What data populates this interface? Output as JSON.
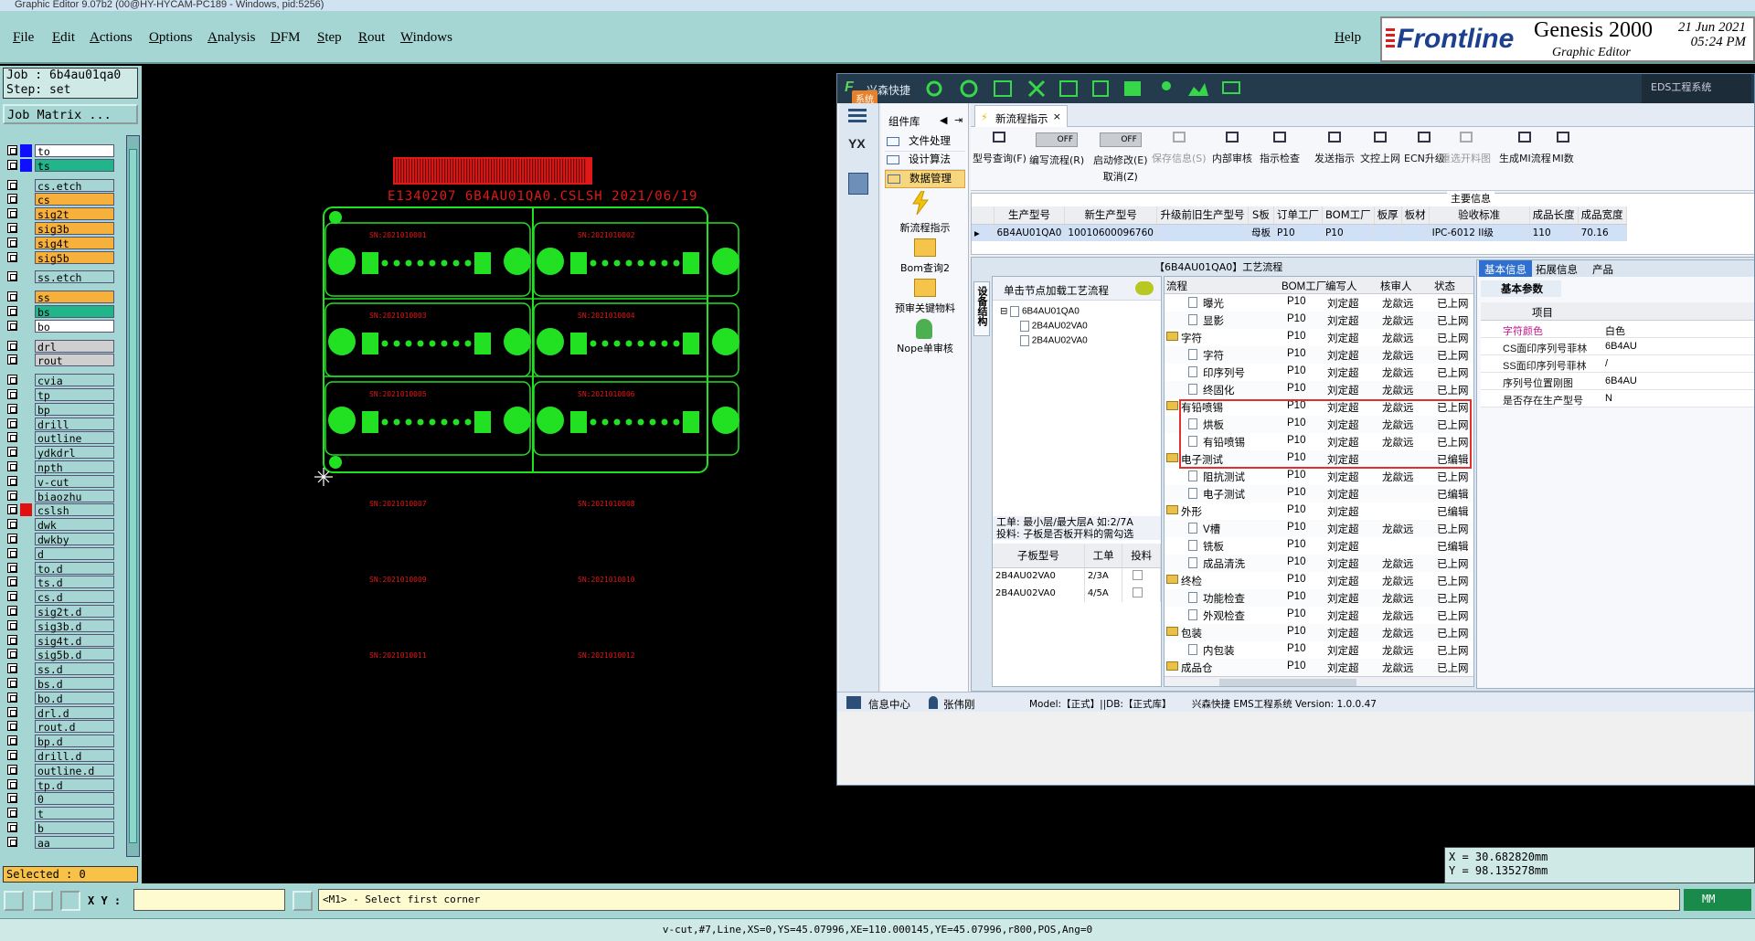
{
  "titlebar": {
    "text": "Graphic Editor 9.07b2 (00@HY-HYCAM-PC189 - Windows, pid:5256)"
  },
  "menu": {
    "items": [
      "File",
      "Edit",
      "Actions",
      "Options",
      "Analysis",
      "DFM",
      "Step",
      "Rout",
      "Windows"
    ],
    "help": "Help"
  },
  "brand": {
    "logo": "Frontline",
    "product": "Genesis 2000",
    "subtitle": "Graphic Editor",
    "date": "21 Jun 2021",
    "time": "05:24 PM"
  },
  "job": {
    "job_label": "Job  : 6b4au01qa0",
    "step_label": "Step: set",
    "matrix_button": "Job Matrix ..."
  },
  "layers": [
    {
      "name": "to",
      "color": "#1010ff",
      "bg": "#ffffff"
    },
    {
      "name": "ts",
      "color": "#1010ff",
      "bg": "#21b58a"
    },
    {
      "name": "cs.etch",
      "color": "",
      "bg": "#a5d6d3"
    },
    {
      "name": "cs",
      "color": "",
      "bg": "#f7b13b"
    },
    {
      "name": "sig2t",
      "color": "",
      "bg": "#f7b13b"
    },
    {
      "name": "sig3b",
      "color": "",
      "bg": "#f7b13b"
    },
    {
      "name": "sig4t",
      "color": "",
      "bg": "#f7b13b"
    },
    {
      "name": "sig5b",
      "color": "",
      "bg": "#f7b13b"
    },
    {
      "name": "ss.etch",
      "color": "",
      "bg": "#a5d6d3"
    },
    {
      "name": "ss",
      "color": "",
      "bg": "#f7b13b"
    },
    {
      "name": "bs",
      "color": "",
      "bg": "#21b58a"
    },
    {
      "name": "bo",
      "color": "",
      "bg": "#ffffff"
    },
    {
      "name": "drl",
      "color": "",
      "bg": "#cfcfcf"
    },
    {
      "name": "rout",
      "color": "",
      "bg": "#cfcfcf"
    },
    {
      "name": "cvia",
      "color": "",
      "bg": "#a5d6d3"
    },
    {
      "name": "tp",
      "color": "",
      "bg": "#a5d6d3"
    },
    {
      "name": "bp",
      "color": "",
      "bg": "#a5d6d3"
    },
    {
      "name": "drill",
      "color": "",
      "bg": "#a5d6d3"
    },
    {
      "name": "outline",
      "color": "",
      "bg": "#a5d6d3"
    },
    {
      "name": "ydkdrl",
      "color": "",
      "bg": "#a5d6d3"
    },
    {
      "name": "npth",
      "color": "",
      "bg": "#a5d6d3"
    },
    {
      "name": "v-cut",
      "color": "",
      "bg": "#a5d6d3"
    },
    {
      "name": "biaozhu",
      "color": "",
      "bg": "#a5d6d3"
    },
    {
      "name": "cslsh",
      "color": "#e01010",
      "bg": "#a5d6d3"
    },
    {
      "name": "dwk",
      "color": "",
      "bg": "#a5d6d3"
    },
    {
      "name": "dwkby",
      "color": "",
      "bg": "#a5d6d3"
    },
    {
      "name": "d",
      "color": "",
      "bg": "#a5d6d3"
    },
    {
      "name": "to.d",
      "color": "",
      "bg": "#a5d6d3"
    },
    {
      "name": "ts.d",
      "color": "",
      "bg": "#a5d6d3"
    },
    {
      "name": "cs.d",
      "color": "",
      "bg": "#a5d6d3"
    },
    {
      "name": "sig2t.d",
      "color": "",
      "bg": "#a5d6d3"
    },
    {
      "name": "sig3b.d",
      "color": "",
      "bg": "#a5d6d3"
    },
    {
      "name": "sig4t.d",
      "color": "",
      "bg": "#a5d6d3"
    },
    {
      "name": "sig5b.d",
      "color": "",
      "bg": "#a5d6d3"
    },
    {
      "name": "ss.d",
      "color": "",
      "bg": "#a5d6d3"
    },
    {
      "name": "bs.d",
      "color": "",
      "bg": "#a5d6d3"
    },
    {
      "name": "bo.d",
      "color": "",
      "bg": "#a5d6d3"
    },
    {
      "name": "drl.d",
      "color": "",
      "bg": "#a5d6d3"
    },
    {
      "name": "rout.d",
      "color": "",
      "bg": "#a5d6d3"
    },
    {
      "name": "bp.d",
      "color": "",
      "bg": "#a5d6d3"
    },
    {
      "name": "drill.d",
      "color": "",
      "bg": "#a5d6d3"
    },
    {
      "name": "outline.d",
      "color": "",
      "bg": "#a5d6d3"
    },
    {
      "name": "tp.d",
      "color": "",
      "bg": "#a5d6d3"
    },
    {
      "name": "0",
      "color": "",
      "bg": "#a5d6d3"
    },
    {
      "name": "t",
      "color": "",
      "bg": "#a5d6d3"
    },
    {
      "name": "b",
      "color": "",
      "bg": "#a5d6d3"
    },
    {
      "name": "aa",
      "color": "",
      "bg": "#a5d6d3"
    }
  ],
  "selected": "Selected : 0",
  "board": {
    "header_text": "E1340207 6B4AU01QA0.CSLSH 2021/06/19",
    "sn_labels": [
      "SN:2021010001",
      "SN:2021010002",
      "SN:2021010003",
      "SN:2021010004",
      "SN:2021010005",
      "SN:2021010006",
      "SN:2021010007",
      "SN:2021010008",
      "SN:2021010009",
      "SN:2021010010",
      "SN:2021010011",
      "SN:2021010012"
    ]
  },
  "coords": {
    "x": "X  = 30.682820mm",
    "y": "Y  = 98.135278mm"
  },
  "bottom": {
    "xy_label": "X Y :",
    "xy_value": "",
    "prompt": "<M1> - Select first corner",
    "units": "MM",
    "status": "v-cut,#7,Line,XS=0,YS=45.07996,XE=110.000145,YE=45.07996,r800,POS,Ang=0"
  },
  "eds": {
    "app_name": "兴森快捷",
    "system_label": "系统",
    "title_right": "EDS工程系统",
    "component_lib": "组件库",
    "sidebar_items": [
      "文件处理",
      "设计算法",
      "数据管理"
    ],
    "func_items": [
      "新流程指示",
      "Bom查询2",
      "预审关键物料",
      "Nope单审核"
    ],
    "yx_label": "YX",
    "tab": "新流程指示",
    "toolbar": [
      {
        "label": "型号查询(F)",
        "toggle": ""
      },
      {
        "label": "编写流程(R)",
        "toggle": "OFF"
      },
      {
        "label": "启动修改(E)",
        "sub": "取消(Z)",
        "toggle": "OFF"
      },
      {
        "label": "保存信息(S)",
        "toggle": ""
      },
      {
        "label": "内部审核",
        "toggle": ""
      },
      {
        "label": "指示检查",
        "toggle": ""
      },
      {
        "label": "发送指示",
        "toggle": ""
      },
      {
        "label": "文控上网",
        "toggle": ""
      },
      {
        "label": "ECN升级",
        "toggle": ""
      },
      {
        "label": "重选开料图",
        "toggle": ""
      },
      {
        "label": "生成MI流程",
        "toggle": ""
      },
      {
        "label": "MI数",
        "toggle": ""
      }
    ],
    "main_info": "主要信息",
    "info_headers": [
      "生产型号",
      "新生产型号",
      "升级前旧生产型号",
      "S板",
      "订单工厂",
      "BOM工厂",
      "板厚",
      "板材",
      "验收标准",
      "成品长度",
      "成品宽度"
    ],
    "info_row": [
      "6B4AU01QA0",
      "10010600096760",
      "",
      "母板",
      "P10",
      "P10",
      "",
      "",
      "IPC-6012 II级",
      "110",
      "70.16"
    ],
    "process_title": "【6B4AU01QA0】工艺流程",
    "vertical_tab": "设备结构",
    "hint": "单击节点加载工艺流程",
    "tree": [
      "6B4AU01QA0",
      "2B4AU02VA0",
      "2B4AU02VA0"
    ],
    "note1": "工单: 最小层/最大层A 如:2/7A",
    "note2": "投料: 子板是否板开料的需勾选",
    "sub_headers": [
      "子板型号",
      "工单",
      "投料"
    ],
    "sub_rows": [
      [
        "2B4AU02VA0",
        "2/3A"
      ],
      [
        "2B4AU02VA0",
        "4/5A"
      ]
    ],
    "flow_headers": [
      "流程",
      "BOM工厂",
      "编写人",
      "核审人",
      "状态"
    ],
    "flow_rows": [
      {
        "name": "曝光",
        "lvl": 2,
        "type": "doc",
        "f": "P10",
        "w": "刘定超",
        "r": "龙歘远",
        "s": "已上网"
      },
      {
        "name": "显影",
        "lvl": 2,
        "type": "doc",
        "f": "P10",
        "w": "刘定超",
        "r": "龙歘远",
        "s": "已上网"
      },
      {
        "name": "字符",
        "lvl": 1,
        "type": "fold",
        "f": "P10",
        "w": "刘定超",
        "r": "龙歘远",
        "s": "已上网"
      },
      {
        "name": "字符",
        "lvl": 2,
        "type": "doc",
        "f": "P10",
        "w": "刘定超",
        "r": "龙歘远",
        "s": "已上网"
      },
      {
        "name": "印序列号",
        "lvl": 2,
        "type": "doc",
        "f": "P10",
        "w": "刘定超",
        "r": "龙歘远",
        "s": "已上网"
      },
      {
        "name": "终固化",
        "lvl": 2,
        "type": "doc",
        "f": "P10",
        "w": "刘定超",
        "r": "龙歘远",
        "s": "已上网"
      },
      {
        "name": "有铅喷锡",
        "lvl": 1,
        "type": "fold",
        "f": "P10",
        "w": "刘定超",
        "r": "龙歘远",
        "s": "已上网"
      },
      {
        "name": "烘板",
        "lvl": 2,
        "type": "doc",
        "f": "P10",
        "w": "刘定超",
        "r": "龙歘远",
        "s": "已上网"
      },
      {
        "name": "有铅喷锡",
        "lvl": 2,
        "type": "doc",
        "f": "P10",
        "w": "刘定超",
        "r": "龙歘远",
        "s": "已上网"
      },
      {
        "name": "电子测试",
        "lvl": 1,
        "type": "fold",
        "f": "P10",
        "w": "刘定超",
        "r": "",
        "s": "已编辑"
      },
      {
        "name": "阻抗测试",
        "lvl": 2,
        "type": "doc",
        "f": "P10",
        "w": "刘定超",
        "r": "龙歘远",
        "s": "已上网"
      },
      {
        "name": "电子测试",
        "lvl": 2,
        "type": "doc",
        "f": "P10",
        "w": "刘定超",
        "r": "",
        "s": "已编辑"
      },
      {
        "name": "外形",
        "lvl": 1,
        "type": "fold",
        "f": "P10",
        "w": "刘定超",
        "r": "",
        "s": "已编辑"
      },
      {
        "name": "V槽",
        "lvl": 2,
        "type": "doc",
        "f": "P10",
        "w": "刘定超",
        "r": "龙歘远",
        "s": "已上网"
      },
      {
        "name": "铣板",
        "lvl": 2,
        "type": "doc",
        "f": "P10",
        "w": "刘定超",
        "r": "",
        "s": "已编辑"
      },
      {
        "name": "成品清洗",
        "lvl": 2,
        "type": "doc",
        "f": "P10",
        "w": "刘定超",
        "r": "龙歘远",
        "s": "已上网"
      },
      {
        "name": "终检",
        "lvl": 1,
        "type": "fold",
        "f": "P10",
        "w": "刘定超",
        "r": "龙歘远",
        "s": "已上网"
      },
      {
        "name": "功能检查",
        "lvl": 2,
        "type": "doc",
        "f": "P10",
        "w": "刘定超",
        "r": "龙歘远",
        "s": "已上网"
      },
      {
        "name": "外观检查",
        "lvl": 2,
        "type": "doc",
        "f": "P10",
        "w": "刘定超",
        "r": "龙歘远",
        "s": "已上网"
      },
      {
        "name": "包装",
        "lvl": 1,
        "type": "fold",
        "f": "P10",
        "w": "刘定超",
        "r": "龙歘远",
        "s": "已上网"
      },
      {
        "name": "内包装",
        "lvl": 2,
        "type": "doc",
        "f": "P10",
        "w": "刘定超",
        "r": "龙歘远",
        "s": "已上网"
      },
      {
        "name": "成品仓",
        "lvl": 1,
        "type": "fold",
        "f": "P10",
        "w": "刘定超",
        "r": "龙歘远",
        "s": "已上网"
      }
    ],
    "right_tabs": [
      "基本信息",
      "拓展信息",
      "产品"
    ],
    "right_sub": "基本参数",
    "right_header": "项目",
    "right_rows": [
      [
        "字符颜色",
        "白色"
      ],
      [
        "CS面印序列号菲林",
        "6B4AU"
      ],
      [
        "SS面印序列号菲林",
        "/"
      ],
      [
        "序列号位置刚图",
        "6B4AU"
      ],
      [
        "是否存在生产型号",
        "N"
      ]
    ],
    "footer": {
      "info_center": "信息中心",
      "user": "张伟刚",
      "model": "Model:【正式】||DB:【正式库】",
      "sys": "兴森快捷  EMS工程系统  Version: 1.0.0.47"
    }
  },
  "colors": {
    "teal": "#a5d6d3",
    "green": "#22e022",
    "red": "#e01818",
    "highlight": "#e03030"
  }
}
